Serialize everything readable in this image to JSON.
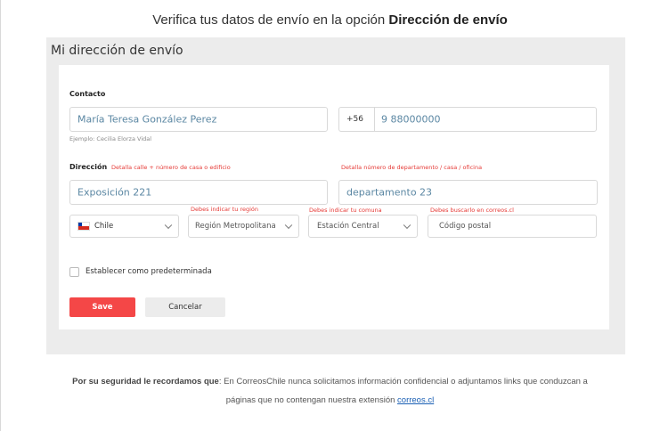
{
  "header": {
    "lead": "Verifica tus datos de envío en la opción ",
    "bold": "Dirección de envío"
  },
  "panel": {
    "title": "Mi dirección de envío"
  },
  "contact": {
    "label": "Contacto",
    "name_value": "María Teresa  González Perez",
    "name_example": "Ejemplo: Cecilia Elorza Vidal",
    "phone_prefix": "+56",
    "phone_value": "9 88000000"
  },
  "address": {
    "label": "Dirección",
    "street_hint": "Detalla calle + número de casa o edificio",
    "apt_hint": "Detalla número de departamento / casa  / oficina",
    "street_value": "Exposición 221",
    "apt_value": "departamento 23",
    "country_value": "Chile",
    "region_error": "Debes indicar tu región",
    "region_value": "Región Metropolitana",
    "commune_error": "Debes indicar tu comuna",
    "commune_value": "Estación Central",
    "postal_error": "Debes buscarlo en correos.cl",
    "postal_placeholder": "Código postal"
  },
  "default_checkbox": {
    "label": "Establecer como predeterminada",
    "checked": false
  },
  "buttons": {
    "save": "Save",
    "cancel": "Cancelar"
  },
  "footer": {
    "bold": "Por su seguridad le recordamos que",
    "text1": ": En CorreosChile nunca solicitamos información confidencial o adjuntamos links que conduzcan a",
    "text2": "páginas que no contengan nuestra extensión ",
    "link": "correos.cl"
  },
  "colors": {
    "accent": "#f44747",
    "error": "#e53935",
    "value_text": "#5b87a3",
    "link": "#1a5fb4"
  }
}
